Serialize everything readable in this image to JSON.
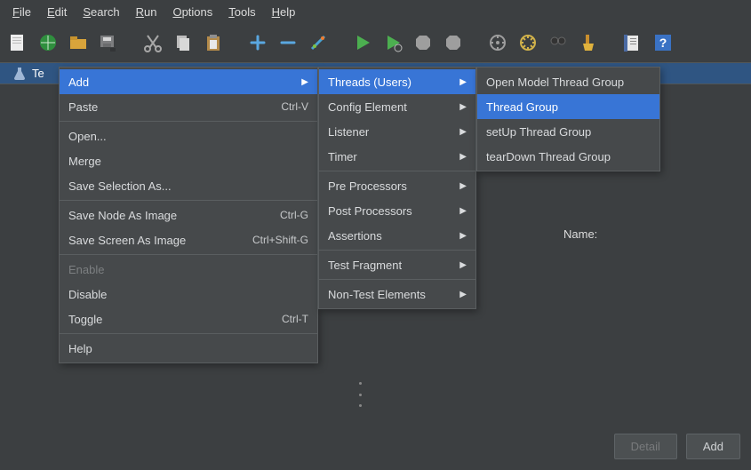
{
  "menubar": {
    "file": "File",
    "edit": "Edit",
    "search": "Search",
    "run": "Run",
    "options": "Options",
    "tools": "Tools",
    "help": "Help"
  },
  "tree": {
    "visible_item_prefix": "Te"
  },
  "form": {
    "name_label": "Name:"
  },
  "footer": {
    "detail": "Detail",
    "add": "Add"
  },
  "context1": {
    "add": "Add",
    "paste": "Paste",
    "paste_sc": "Ctrl-V",
    "open": "Open...",
    "merge": "Merge",
    "save_selection_as": "Save Selection As...",
    "save_node_as_image": "Save Node As Image",
    "save_node_sc": "Ctrl-G",
    "save_screen_as_image": "Save Screen As Image",
    "save_screen_sc": "Ctrl+Shift-G",
    "enable": "Enable",
    "disable": "Disable",
    "toggle": "Toggle",
    "toggle_sc": "Ctrl-T",
    "help": "Help"
  },
  "context2": {
    "threads": "Threads (Users)",
    "config_element": "Config Element",
    "listener": "Listener",
    "timer": "Timer",
    "pre_processors": "Pre Processors",
    "post_processors": "Post Processors",
    "assertions": "Assertions",
    "test_fragment": "Test Fragment",
    "non_test_elements": "Non-Test Elements"
  },
  "context3": {
    "open_model_thread_group": "Open Model Thread Group",
    "thread_group": "Thread Group",
    "setup_thread_group": "setUp Thread Group",
    "teardown_thread_group": "tearDown Thread Group"
  },
  "icons": {
    "page": "#ededed",
    "globe": "#2f8f3e",
    "folder": "#d9a43b",
    "disks": "#7d7e80",
    "cut": "#a8a8a8",
    "doc": "#bdbdbd",
    "clip": "#b38a4a",
    "plus": "#5aa7e0",
    "minus": "#5aa7e0",
    "wand": "#4aa3d1",
    "play1": "#4caf50",
    "play2": "#4caf50",
    "stop1": "#9e9e9e",
    "stop2": "#9e9e9e",
    "gear": "#9e9e9e",
    "cog": "#d1b24a",
    "binoc": "#333333",
    "broom": "#e0b23d",
    "note": "#4a6aa3",
    "help": "#3a72c4",
    "flask": "#9fb7d6"
  }
}
